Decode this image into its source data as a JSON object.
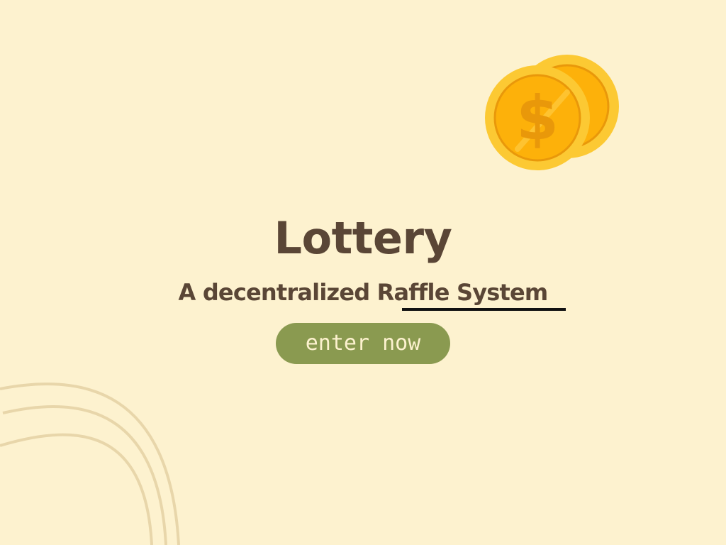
{
  "hero": {
    "title": "Lottery",
    "subtitle": "A decentralized Raffle System",
    "cta_label": "enter now"
  },
  "colors": {
    "background": "#fdf2cf",
    "text": "#5a4636",
    "button": "#8a9a50",
    "button_text": "#fdf2cf",
    "underline": "#111111",
    "coin_light": "#fcc933",
    "coin_mid": "#fdb10a",
    "coin_dark": "#e9980a",
    "decor_arc": "#e8d6aa"
  },
  "icons": {
    "coins": "gold-coins-dollar-icon"
  }
}
